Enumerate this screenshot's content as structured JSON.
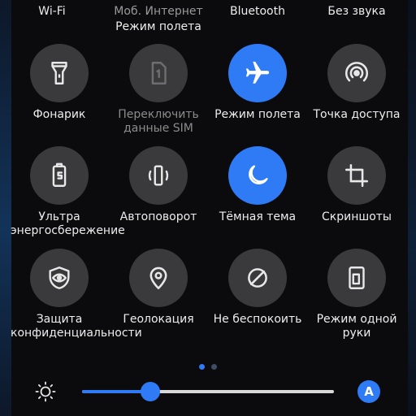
{
  "top_row": [
    {
      "label": "Wi-Fi",
      "sub": ""
    },
    {
      "label": "Моб. Интернет",
      "sub": "Режим полета"
    },
    {
      "label": "Bluetooth",
      "sub": ""
    },
    {
      "label": "Без звука",
      "sub": ""
    }
  ],
  "tiles": [
    {
      "label": "Фонарик",
      "icon": "flashlight-icon",
      "active": false,
      "disabled": false
    },
    {
      "label": "Переключить данные SIM",
      "icon": "sim-card-icon",
      "active": false,
      "disabled": true
    },
    {
      "label": "Режим полета",
      "icon": "airplane-icon",
      "active": true,
      "disabled": false
    },
    {
      "label": "Точка доступа",
      "icon": "hotspot-icon",
      "active": false,
      "disabled": false
    },
    {
      "label": "Ультра энергосбережение",
      "icon": "battery-saver-icon",
      "active": false,
      "disabled": false
    },
    {
      "label": "Автоповорот",
      "icon": "auto-rotate-icon",
      "active": false,
      "disabled": false
    },
    {
      "label": "Тёмная тема",
      "icon": "moon-icon",
      "active": true,
      "disabled": false
    },
    {
      "label": "Скриншоты",
      "icon": "crop-icon",
      "active": false,
      "disabled": false
    },
    {
      "label": "Защита конфиденциальности",
      "icon": "privacy-shield-icon",
      "active": false,
      "disabled": false
    },
    {
      "label": "Геолокация",
      "icon": "location-pin-icon",
      "active": false,
      "disabled": false
    },
    {
      "label": "Не беспокоить",
      "icon": "do-not-disturb-icon",
      "active": false,
      "disabled": false
    },
    {
      "label": "Режим одной руки",
      "icon": "one-hand-mode-icon",
      "active": false,
      "disabled": false
    }
  ],
  "pager": {
    "pages": 2,
    "current": 1
  },
  "brightness": {
    "level": 0.27,
    "auto_label": "A"
  },
  "colors": {
    "accent": "#2f7bf5",
    "tile_off": "#3a3a3c",
    "background": "#0b0b0d"
  }
}
